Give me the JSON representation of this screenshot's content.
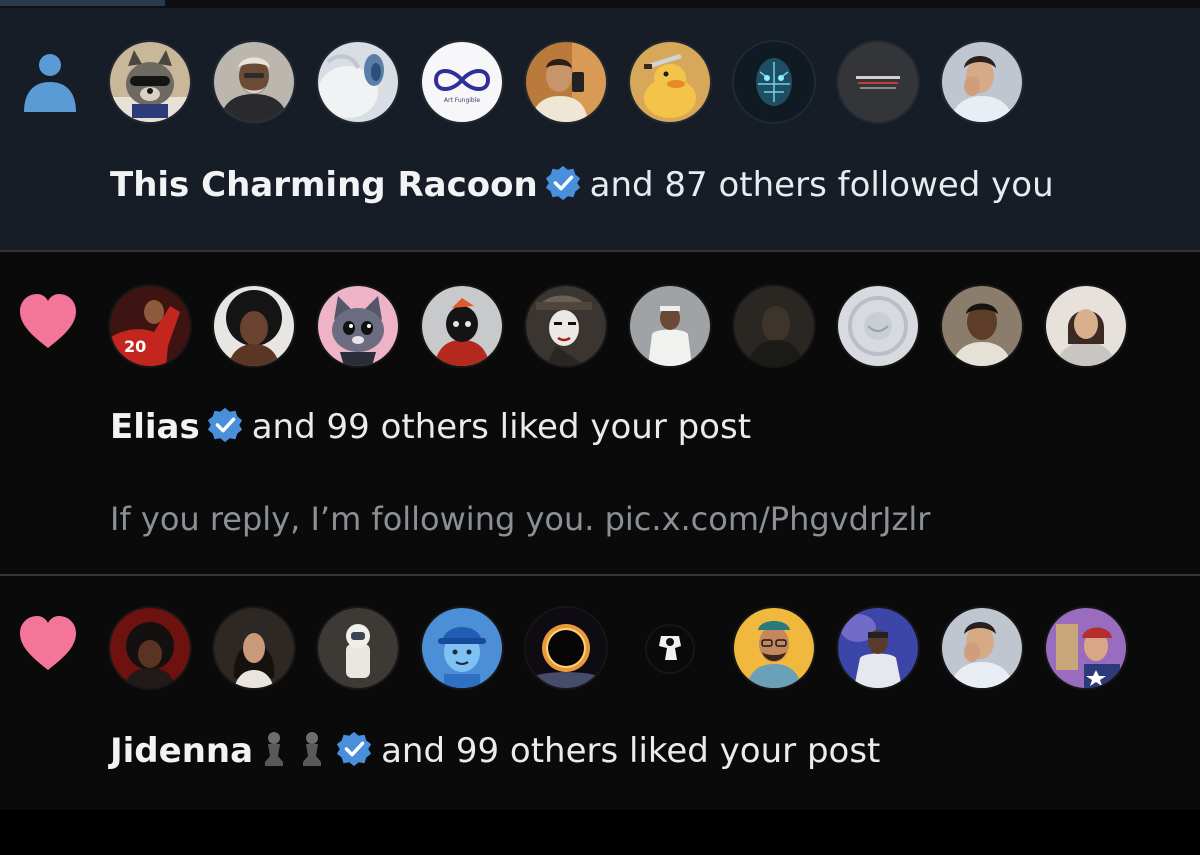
{
  "colors": {
    "follow_icon": "#5b9bd5",
    "heart_icon": "#f4759a",
    "verified_badge": "#4a8fdc",
    "name_text": "#f2f3f5",
    "secondary_text": "#8b9097"
  },
  "notifications": [
    {
      "type": "follow",
      "icon": "person-icon",
      "avatars": [
        "raccoon",
        "elder-man",
        "white-fur",
        "infinity-logo-art-fungible",
        "man-mirror-selfie",
        "duck-with-knife",
        "blue-face-art",
        "grey-badge-logo",
        "man-hand-on-face"
      ],
      "name": "This Charming Racoon",
      "verified": true,
      "text": "and 87 others followed you"
    },
    {
      "type": "like",
      "icon": "heart-icon",
      "avatars": [
        "soccer-player-20",
        "afro-portrait",
        "cartoon-cat",
        "masked-bird-art",
        "mime-face",
        "man-in-white",
        "dark-portrait",
        "emblem-circle",
        "boy-portrait",
        "woman-portrait"
      ],
      "name": "Elias",
      "verified": true,
      "text": "and 99 others liked your post",
      "preview": "If you reply, I’m following you. pic.x.com/PhgvdrJzlr"
    },
    {
      "type": "like",
      "icon": "heart-icon",
      "avatars": [
        "anime-boy-red",
        "woman-long-hair",
        "astronaut",
        "cartoon-boy-cap",
        "solar-eclipse",
        "small-dark-icon",
        "bearded-man-glasses",
        "man-on-stage",
        "man-hand-on-face",
        "girl-with-flag"
      ],
      "name": "Jidenna",
      "verified": true,
      "extra_icons": [
        "pawn-icon",
        "pawn-icon"
      ],
      "text": "and 99 others liked your post"
    }
  ]
}
